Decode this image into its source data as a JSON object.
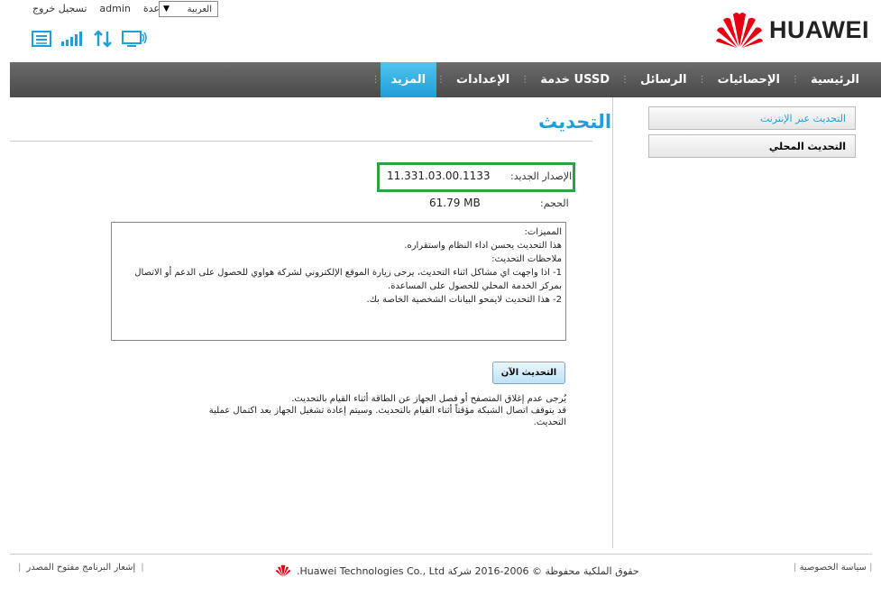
{
  "header": {
    "language": "العربية",
    "help": "مساعدة",
    "user": "admin",
    "logout": "تسجيل خروج",
    "brand": "HUAWEI",
    "brand_color": "#e60012"
  },
  "nav": {
    "items": [
      {
        "label": "الرئيسية"
      },
      {
        "label": "الإحصائيات"
      },
      {
        "label": "الرسائل"
      },
      {
        "label": "خدمة USSD"
      },
      {
        "label": "الإعدادات"
      },
      {
        "label": "المزيد"
      }
    ],
    "active_color": "#1f9fd8"
  },
  "sidebar": {
    "items": [
      {
        "label": "التحديث عبر الإنترنت"
      },
      {
        "label": "التحديث المحلي"
      }
    ]
  },
  "main": {
    "title": "التحديث",
    "new_version_label": "الإصدار الجديد:",
    "new_version_value": "11.331.03.00.1133",
    "size_label": "الحجم:",
    "size_value": "61.79 MB",
    "notes": [
      "المميزات:",
      "هذا التحديث يحسن اداء النظام واستقراره.",
      "ملاحظات التحديث:",
      "1-  اذا واجهت اي مشاكل اثناء التحديث، يرجى زيارة الموقع الإلكتروني لشركة هواوي للحصول على الدعم أو الاتصال بمركز الخدمة المحلي للحصول على المساعدة.",
      "2-  هذا التحديث لايمحو البيانات الشخصية الخاصة بك."
    ],
    "update_button": "التحديث الآن",
    "warnings": [
      "يُرجى عدم إغلاق المتصفح أو فصل الجهاز عن الطاقة أثناء القيام بالتحديث.",
      "قد يتوقف اتصال الشبكة مؤقتاً أثناء القيام بالتحديث. وسيتم إعادة تشغيل الجهاز بعد اكتمال عملية التحديث."
    ],
    "highlight_color": "#2ca33e"
  },
  "footer": {
    "open_source": "إشعار البرنامج مفتوح المصدر",
    "copyright": "حقوق الملكية محفوظة © 2006-2016 شركة Huawei Technologies Co., Ltd.",
    "privacy": "سياسة الخصوصية"
  }
}
